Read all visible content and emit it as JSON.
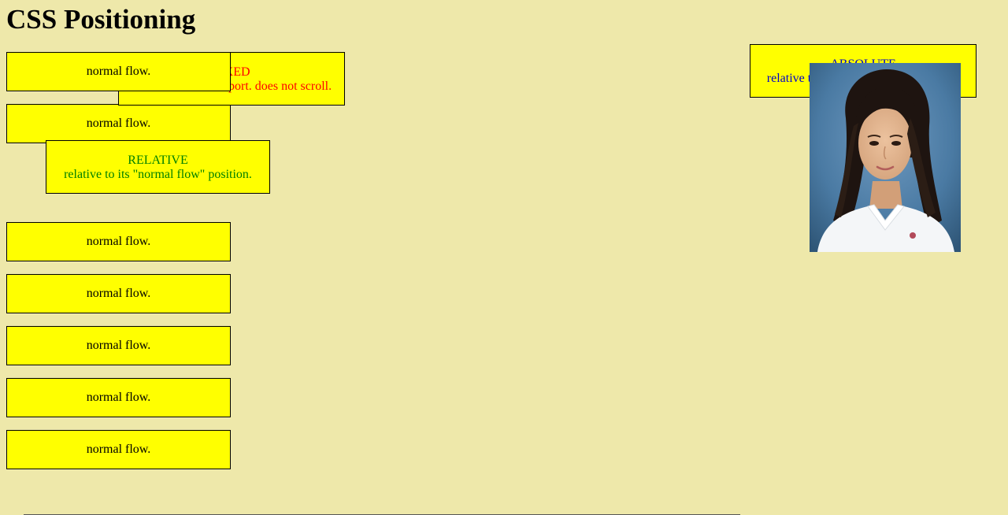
{
  "page": {
    "title": "CSS Positioning"
  },
  "fixed_box": {
    "heading": "FIXED",
    "description": "relative to the viewport. does not scroll."
  },
  "relative_box": {
    "heading": "RELATIVE",
    "description": "relative to its \"normal flow\" position."
  },
  "absolute_box": {
    "heading": "ABSOLUTE",
    "description": "relative to its first positioned ancestor."
  },
  "normal_boxes": [
    {
      "label": "normal flow."
    },
    {
      "label": "normal flow."
    },
    {
      "label": "normal flow."
    },
    {
      "label": "normal flow."
    },
    {
      "label": "normal flow."
    },
    {
      "label": "normal flow."
    },
    {
      "label": "normal flow."
    }
  ],
  "photo": {
    "icon": "portrait-photo",
    "colors": {
      "background": "#4a7aa3",
      "hair": "#1e1410",
      "skin": "#e2b48f",
      "shirt": "#f4f6f8"
    }
  },
  "colors": {
    "page_background": "#eee8aa",
    "box_background": "#ffff00",
    "fixed_text": "#ff0000",
    "relative_text": "#008000",
    "absolute_text": "#0000cc"
  }
}
